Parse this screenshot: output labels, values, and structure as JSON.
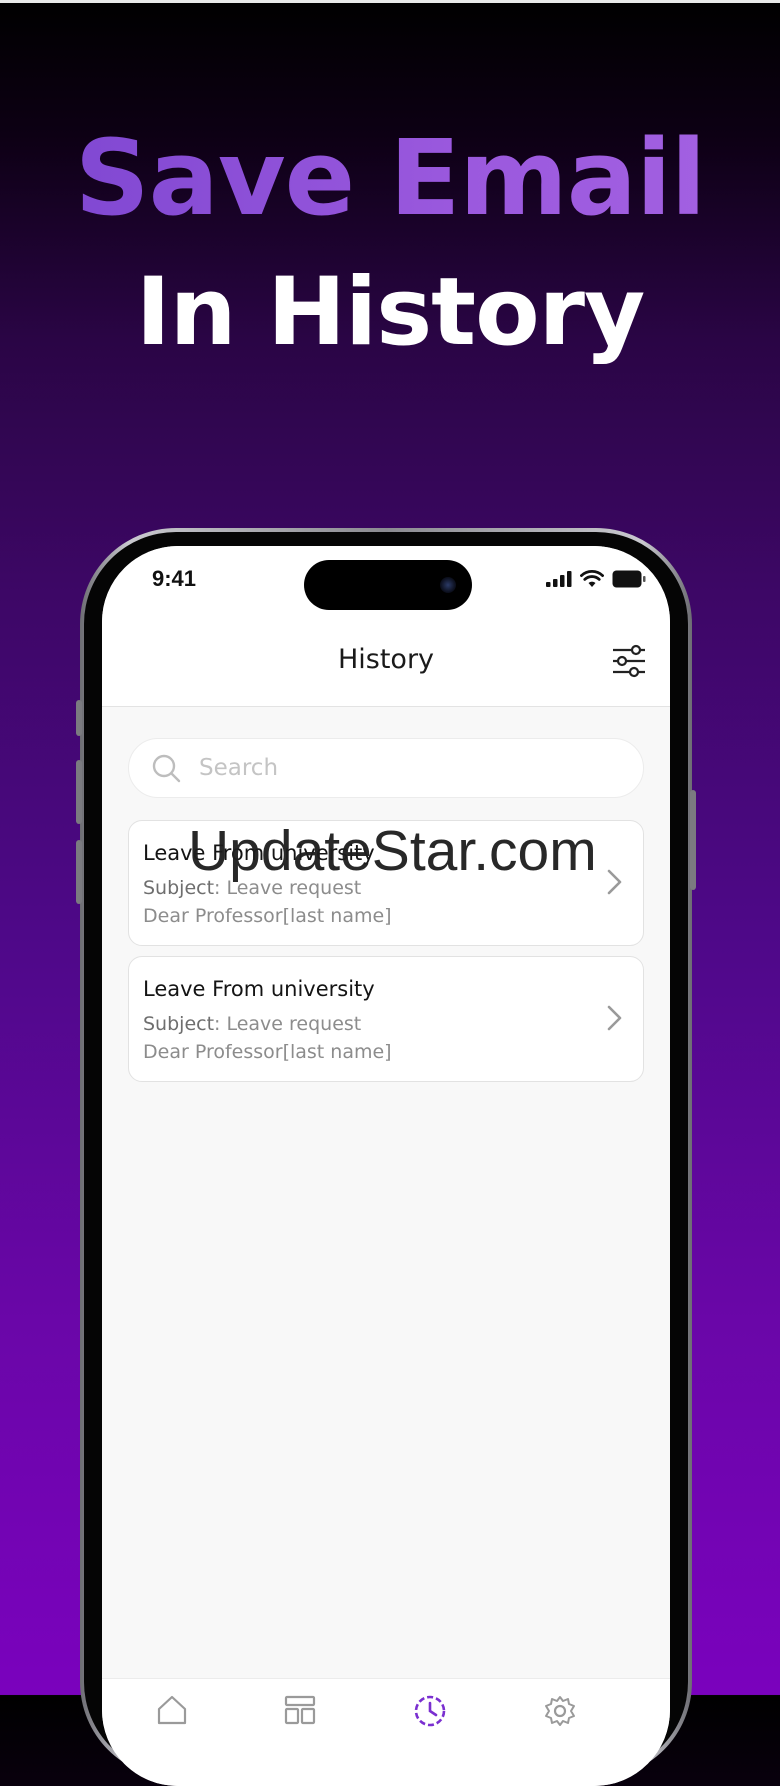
{
  "promo": {
    "headline_line1": "Save Email",
    "headline_line2": "In History"
  },
  "status_bar": {
    "time": "9:41"
  },
  "header": {
    "title": "History",
    "filter_icon": "sliders-icon"
  },
  "search": {
    "placeholder": "Search",
    "icon": "search-icon"
  },
  "history_items": [
    {
      "title": "Leave From university",
      "subject_label": "Subject",
      "subject_value": ": Leave request",
      "preview": "Dear Professor[last name]"
    },
    {
      "title": "Leave From university",
      "subject_label": "Subject",
      "subject_value": ": Leave request",
      "preview": "Dear Professor[last name]"
    }
  ],
  "watermark": {
    "text": "UpdateStar.com"
  },
  "tab_bar": {
    "tabs": [
      {
        "icon": "home-icon"
      },
      {
        "icon": "templates-icon"
      },
      {
        "icon": "history-icon",
        "active": true
      },
      {
        "icon": "settings-icon"
      }
    ]
  },
  "colors": {
    "accent": "#7a2fd0",
    "headline_purple": "#8f4fd9",
    "background_bottom": "#7a02bd"
  }
}
